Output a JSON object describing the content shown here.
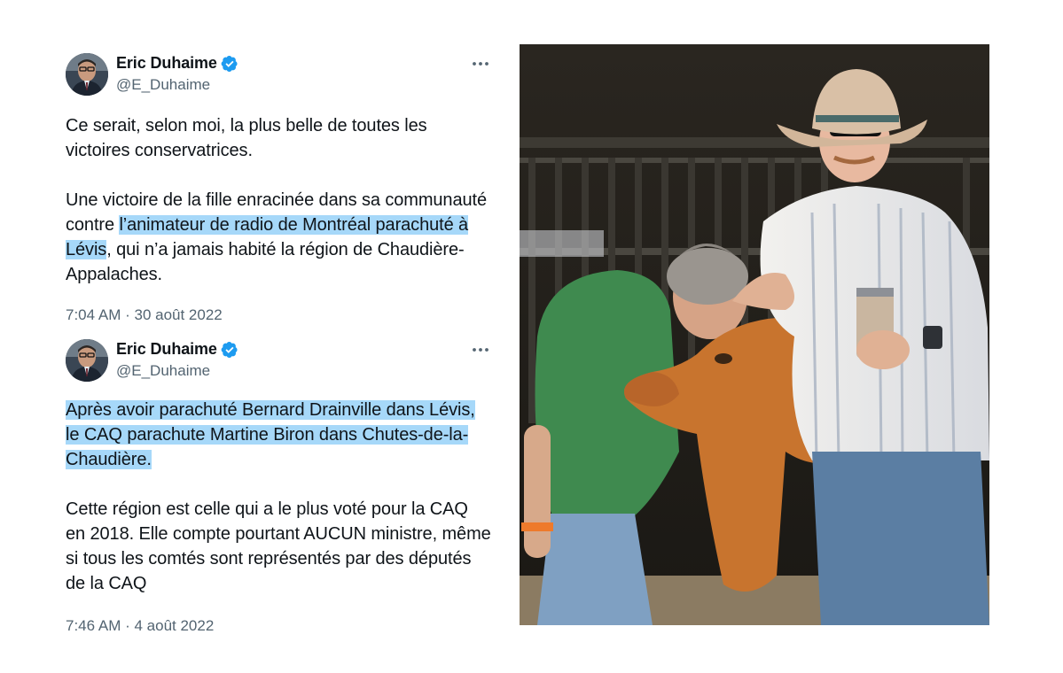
{
  "tweets": [
    {
      "author": {
        "name": "Eric Duhaime",
        "handle": "@E_Duhaime",
        "verified": true
      },
      "paragraphs": [
        {
          "segments": [
            {
              "text": "Ce serait, selon moi, la plus belle de toutes les victoires conservatrices.",
              "highlight": false
            }
          ]
        },
        {
          "segments": [
            {
              "text": "Une victoire de la fille enracinée dans sa communauté contre ",
              "highlight": false
            },
            {
              "text": "l’animateur de radio de Montréal parachuté à Lévis",
              "highlight": true
            },
            {
              "text": ", qui n’a jamais habité la région de Chaudière-Appalaches.",
              "highlight": false
            }
          ]
        }
      ],
      "time": "7:04 AM",
      "separator": " · ",
      "date": "30 août 2022"
    },
    {
      "author": {
        "name": "Eric Duhaime",
        "handle": "@E_Duhaime",
        "verified": true
      },
      "paragraphs": [
        {
          "segments": [
            {
              "text": "Après avoir parachuté Bernard Drainville dans Lévis, le CAQ parachute Martine Biron dans Chutes-de-la-Chaudière.",
              "highlight": true
            }
          ]
        },
        {
          "segments": [
            {
              "text": "Cette région est celle qui a le plus voté pour la CAQ en 2018. Elle compte pourtant AUCUN ministre, même si tous les comtés sont représentés par des députés de la CAQ",
              "highlight": false
            }
          ]
        }
      ],
      "time": "7:46 AM",
      "separator": " · ",
      "date": "4 août 2022"
    }
  ],
  "icons": {
    "verified": "verified-badge-icon",
    "more": "more-options-icon"
  },
  "colors": {
    "highlight": "#a6d8f9",
    "verified": "#1d9bf0",
    "secondary_text": "#536471",
    "text": "#0f1419"
  }
}
